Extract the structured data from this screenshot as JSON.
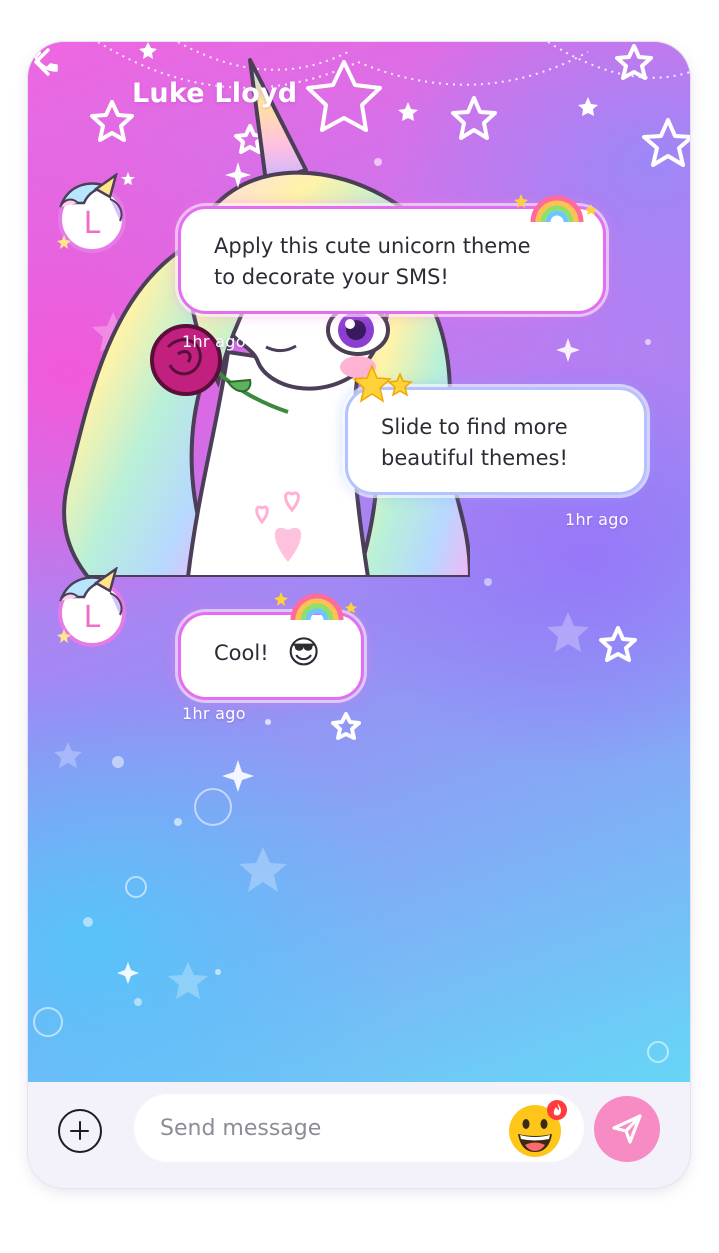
{
  "header": {
    "contact_name": "Luke Lloyd",
    "back_icon": "chevron-left-icon",
    "call_icon": "phone-icon"
  },
  "messages": [
    {
      "direction": "incoming",
      "avatar_letter": "L",
      "lines": [
        "Apply this cute unicorn theme",
        "to decorate your SMS!"
      ],
      "time": "1hr ago"
    },
    {
      "direction": "outgoing",
      "lines": [
        "Slide to find more",
        "beautiful themes!"
      ],
      "time": "1hr ago"
    },
    {
      "direction": "incoming",
      "avatar_letter": "L",
      "lines": [
        "Cool!"
      ],
      "emoji": "😎",
      "time": "1hr ago"
    }
  ],
  "composer": {
    "placeholder": "Send message",
    "add_icon": "plus-circle-icon",
    "emoji_icon": "grinning-face-icon",
    "send_icon": "paper-plane-icon"
  },
  "colors": {
    "incoming_border": "#e36ff0",
    "outgoing_border": "#b4c2ff",
    "send_button": "#f78bc4",
    "composer_bg": "#f3f2fb"
  }
}
